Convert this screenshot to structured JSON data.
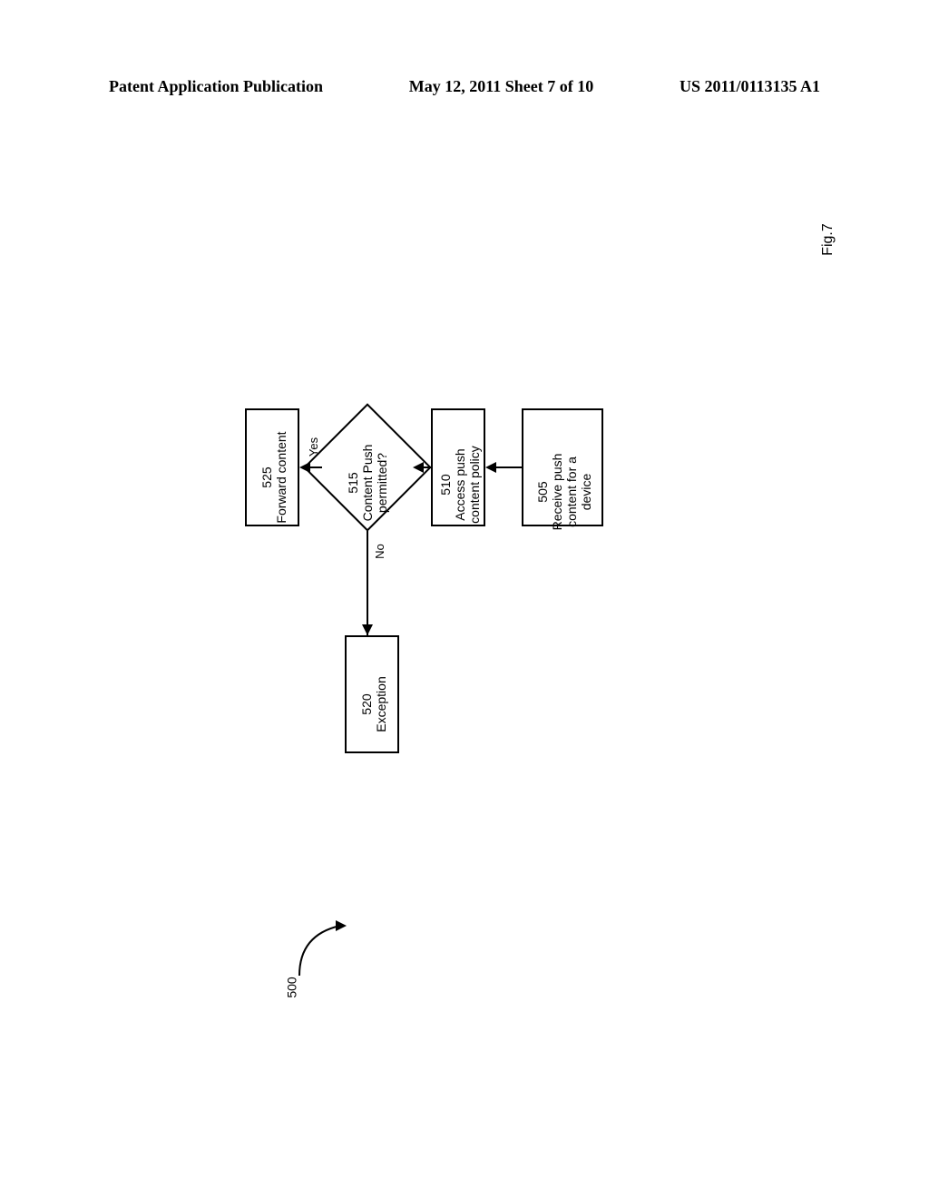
{
  "header": {
    "left": "Patent Application Publication",
    "center": "May 12, 2011  Sheet 7 of 10",
    "right": "US 2011/0113135 A1"
  },
  "flowchart": {
    "box_505": {
      "num": "505",
      "line1": "Receive push",
      "line2": "content for a",
      "line3": "device"
    },
    "box_510": {
      "num": "510",
      "line1": "Access push",
      "line2": "content policy"
    },
    "diamond_515": {
      "num": "515",
      "line1": "Content Push",
      "line2": "permitted?"
    },
    "box_520": {
      "num": "520",
      "line1": "Exception"
    },
    "box_525": {
      "num": "525",
      "line1": "Forward content"
    },
    "labels": {
      "yes": "Yes",
      "no": "No"
    }
  },
  "figure_label": "Fig.7",
  "reference_num": "500"
}
